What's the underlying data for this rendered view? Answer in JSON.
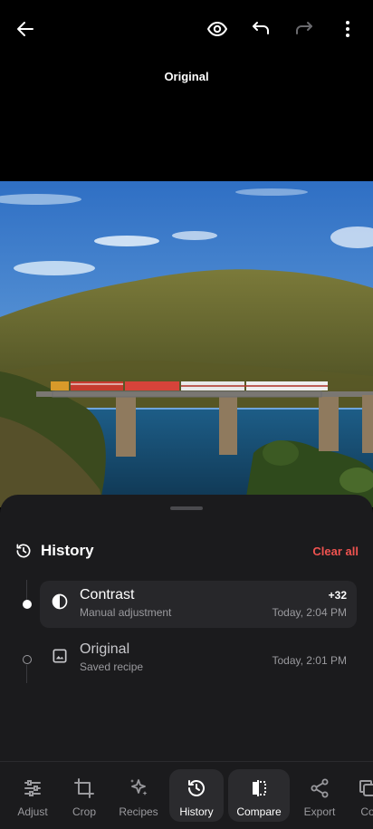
{
  "topbar": {
    "back_icon": "arrow-left-icon",
    "preview_icon": "eye-icon",
    "undo_icon": "undo-icon",
    "redo_icon": "redo-icon",
    "more_icon": "more-vertical-icon"
  },
  "view_mode_label": "Original",
  "photo": {
    "subject": "train crossing bridge over river with hill"
  },
  "history_panel": {
    "title": "History",
    "clear_label": "Clear all",
    "clear_color": "#ef5350",
    "entries": [
      {
        "title": "Contrast",
        "subtitle": "Manual adjustment",
        "value": "+32",
        "time": "Today, 2:04 PM",
        "icon": "contrast-icon",
        "active": true
      },
      {
        "title": "Original",
        "subtitle": "Saved recipe",
        "value": "",
        "time": "Today, 2:01 PM",
        "icon": "image-icon",
        "active": false
      }
    ]
  },
  "toolbar": {
    "items": [
      {
        "label": "Adjust",
        "icon": "sliders-icon"
      },
      {
        "label": "Crop",
        "icon": "crop-icon"
      },
      {
        "label": "Recipes",
        "icon": "sparkles-icon"
      },
      {
        "label": "History",
        "icon": "history-icon",
        "selected": true
      },
      {
        "label": "Compare",
        "icon": "compare-icon",
        "selected": true
      },
      {
        "label": "Export",
        "icon": "share-icon"
      },
      {
        "label": "Co",
        "icon": "copy-icon"
      }
    ]
  }
}
